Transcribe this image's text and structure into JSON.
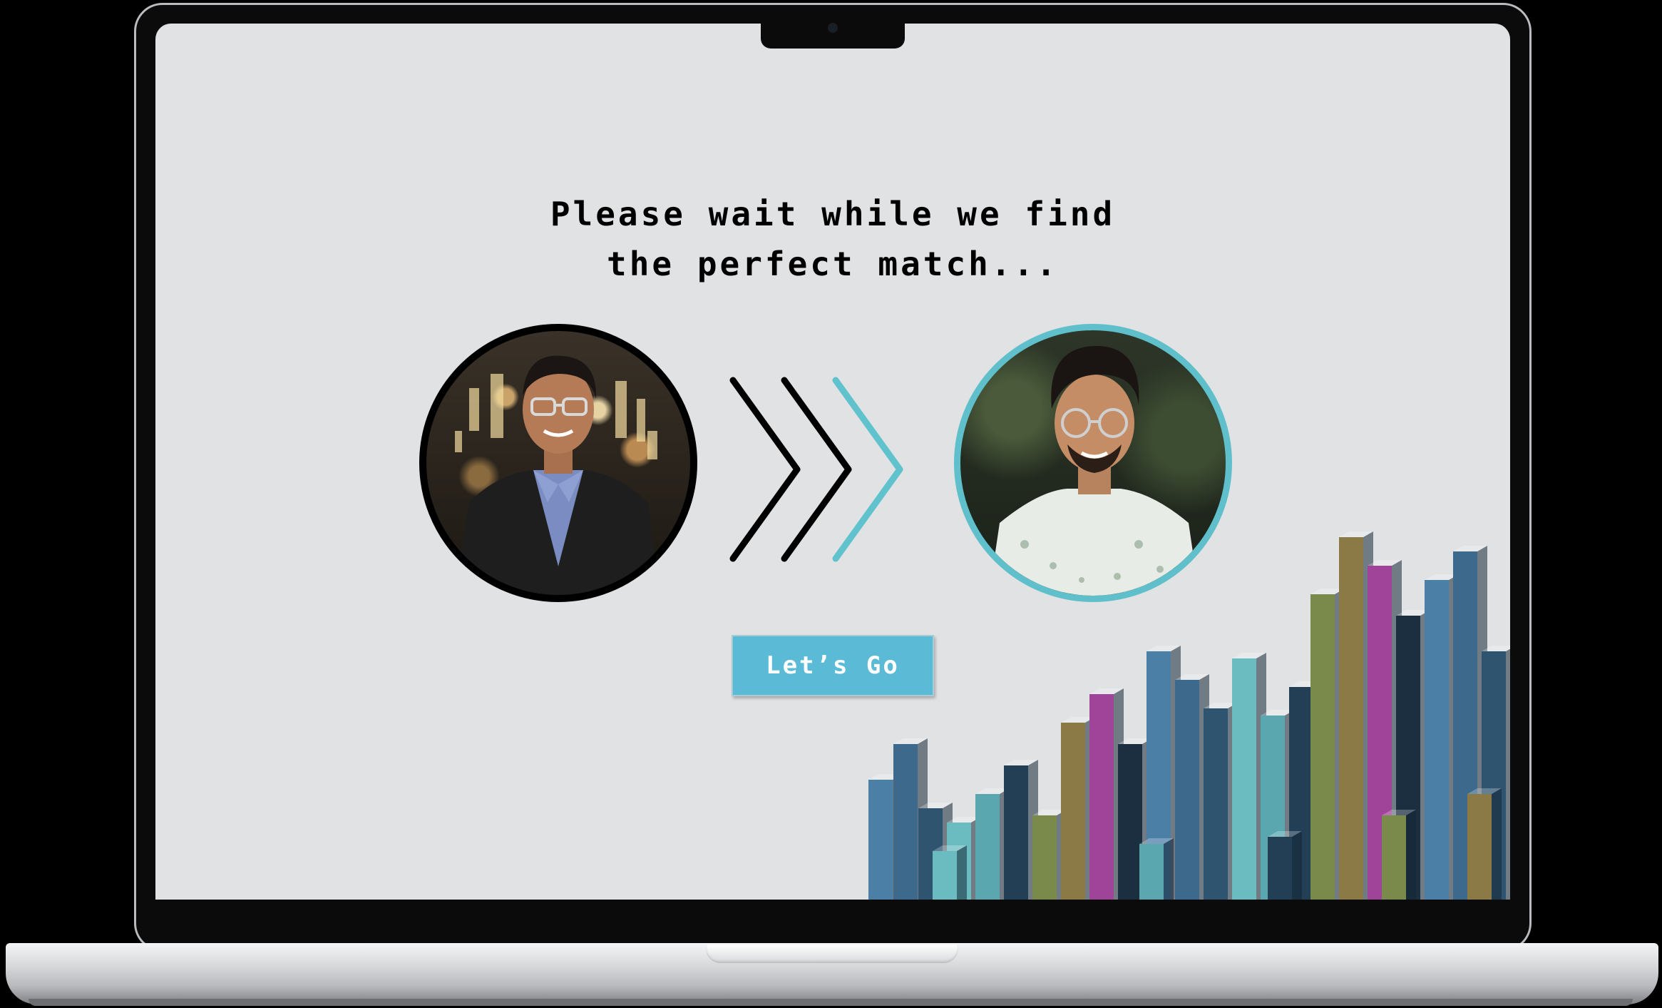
{
  "screen": {
    "headline_line1": "Please wait while we find",
    "headline_line2": "the perfect match...",
    "button_label": "Let’s Go",
    "chevron_colors": [
      "#000000",
      "#000000",
      "#5fc2cc"
    ],
    "accent_color": "#5bbad6",
    "background_color": "#e0e2e4",
    "left_avatar_icon": "person-photo",
    "right_avatar_icon": "person-photo",
    "decoration": "voxel-city-illustration"
  }
}
